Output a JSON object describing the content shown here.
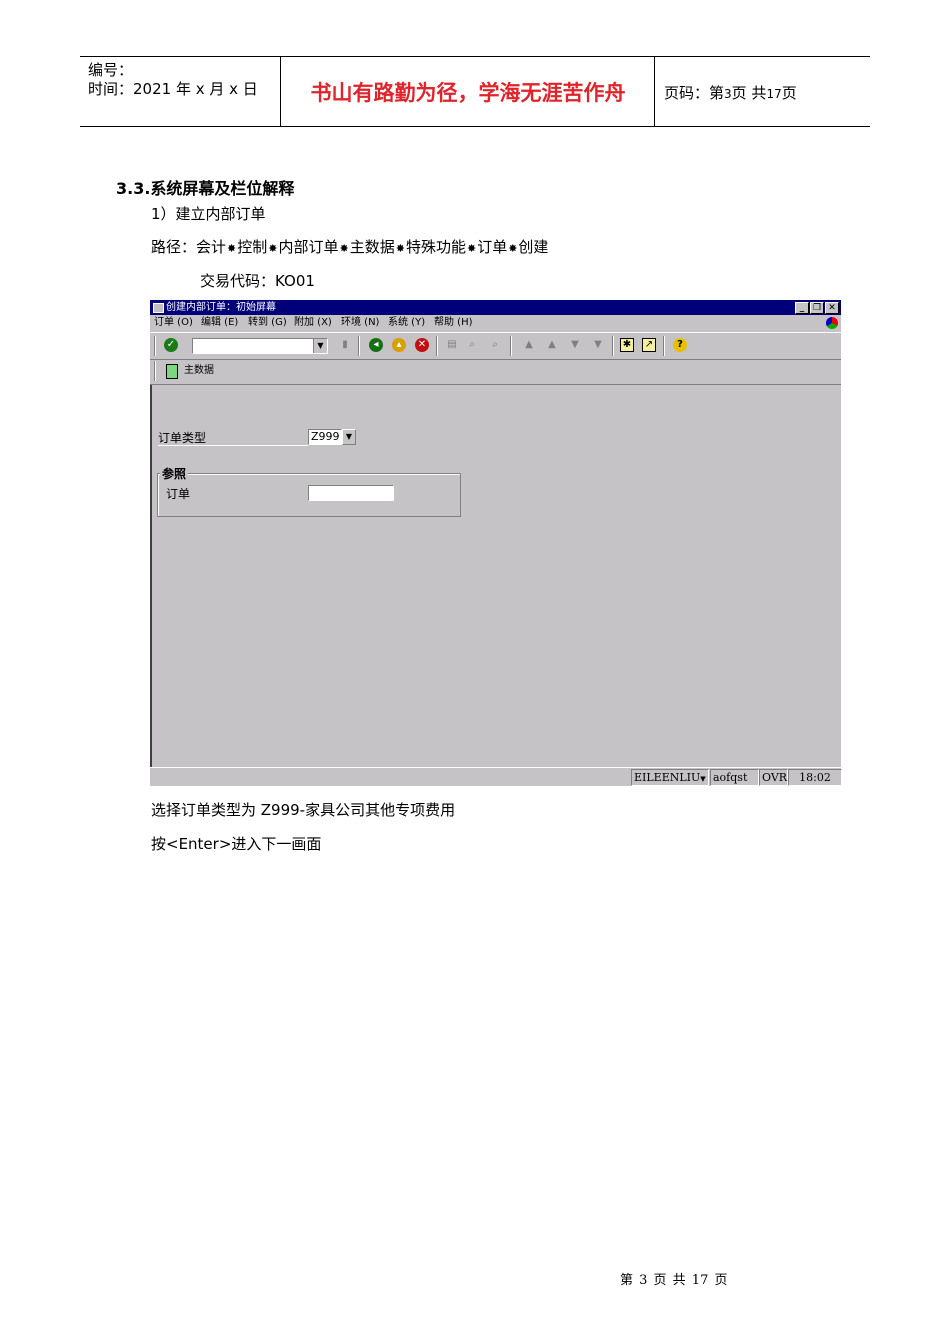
{
  "header": {
    "number_label": "编号：",
    "date_label": "时间：2021 年 x 月 x 日",
    "motto": "书山有路勤为径，学海无涯苦作舟",
    "page_prefix": "页码：第",
    "page_current": "3",
    "page_mid": "页  共",
    "page_total": "17",
    "page_suffix": "页"
  },
  "content": {
    "section_title": "3.3.系统屏幕及栏位解释",
    "item1": "1）建立内部订单",
    "path_prefix": "路径：",
    "path_items": [
      "会计",
      "控制",
      "内部订单",
      "主数据",
      "特殊功能",
      "订单",
      "创建"
    ],
    "path_sep": "✸",
    "tcode": "交易代码：KO01",
    "note1": "选择订单类型为 Z999-家具公司其他专项费用",
    "note2": "按<Enter>进入下一画面"
  },
  "sap": {
    "title": "创建内部订单：初始屏幕",
    "menu": [
      "订单 (O)",
      "编辑 (E)",
      "转到 (G)",
      "附加 (X)",
      "环境 (N)",
      "系统 (Y)",
      "帮助 (H)"
    ],
    "app_button": "主数据",
    "field_order_type": "订单类型",
    "order_type_value": "Z999",
    "group_title": "参照",
    "field_order": "订单",
    "status_user": "EILEENLIU",
    "status_client": "aofqst",
    "status_mode": "OVR",
    "status_time": "18:02"
  },
  "footer": {
    "text": "第 3 页 共 17 页"
  },
  "colors": {
    "motto": "#e0242c",
    "sap_bg": "#c6c3c6",
    "titlebar": "#00007b"
  }
}
